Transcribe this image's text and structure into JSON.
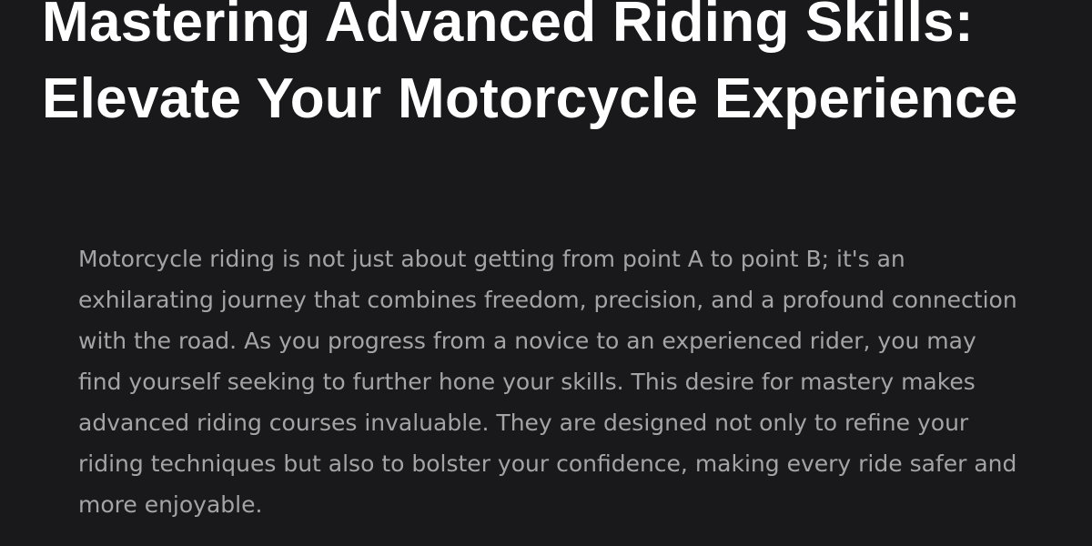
{
  "article": {
    "title": "Mastering Advanced Riding Skills: Elevate Your Motorcycle Experience",
    "intro": "Motorcycle riding is not just about getting from point A to point B; it's an exhilarating journey that combines freedom, precision, and a profound connection with the road. As you progress from a novice to an experienced rider, you may find yourself seeking to further hone your skills. This desire for mastery makes advanced riding courses invaluable. They are designed not only to refine your riding techniques but also to bolster your confidence, making every ride safer and more enjoyable."
  },
  "colors": {
    "background": "#19191b",
    "title": "#ffffff",
    "body_text": "#a4a4a8"
  }
}
